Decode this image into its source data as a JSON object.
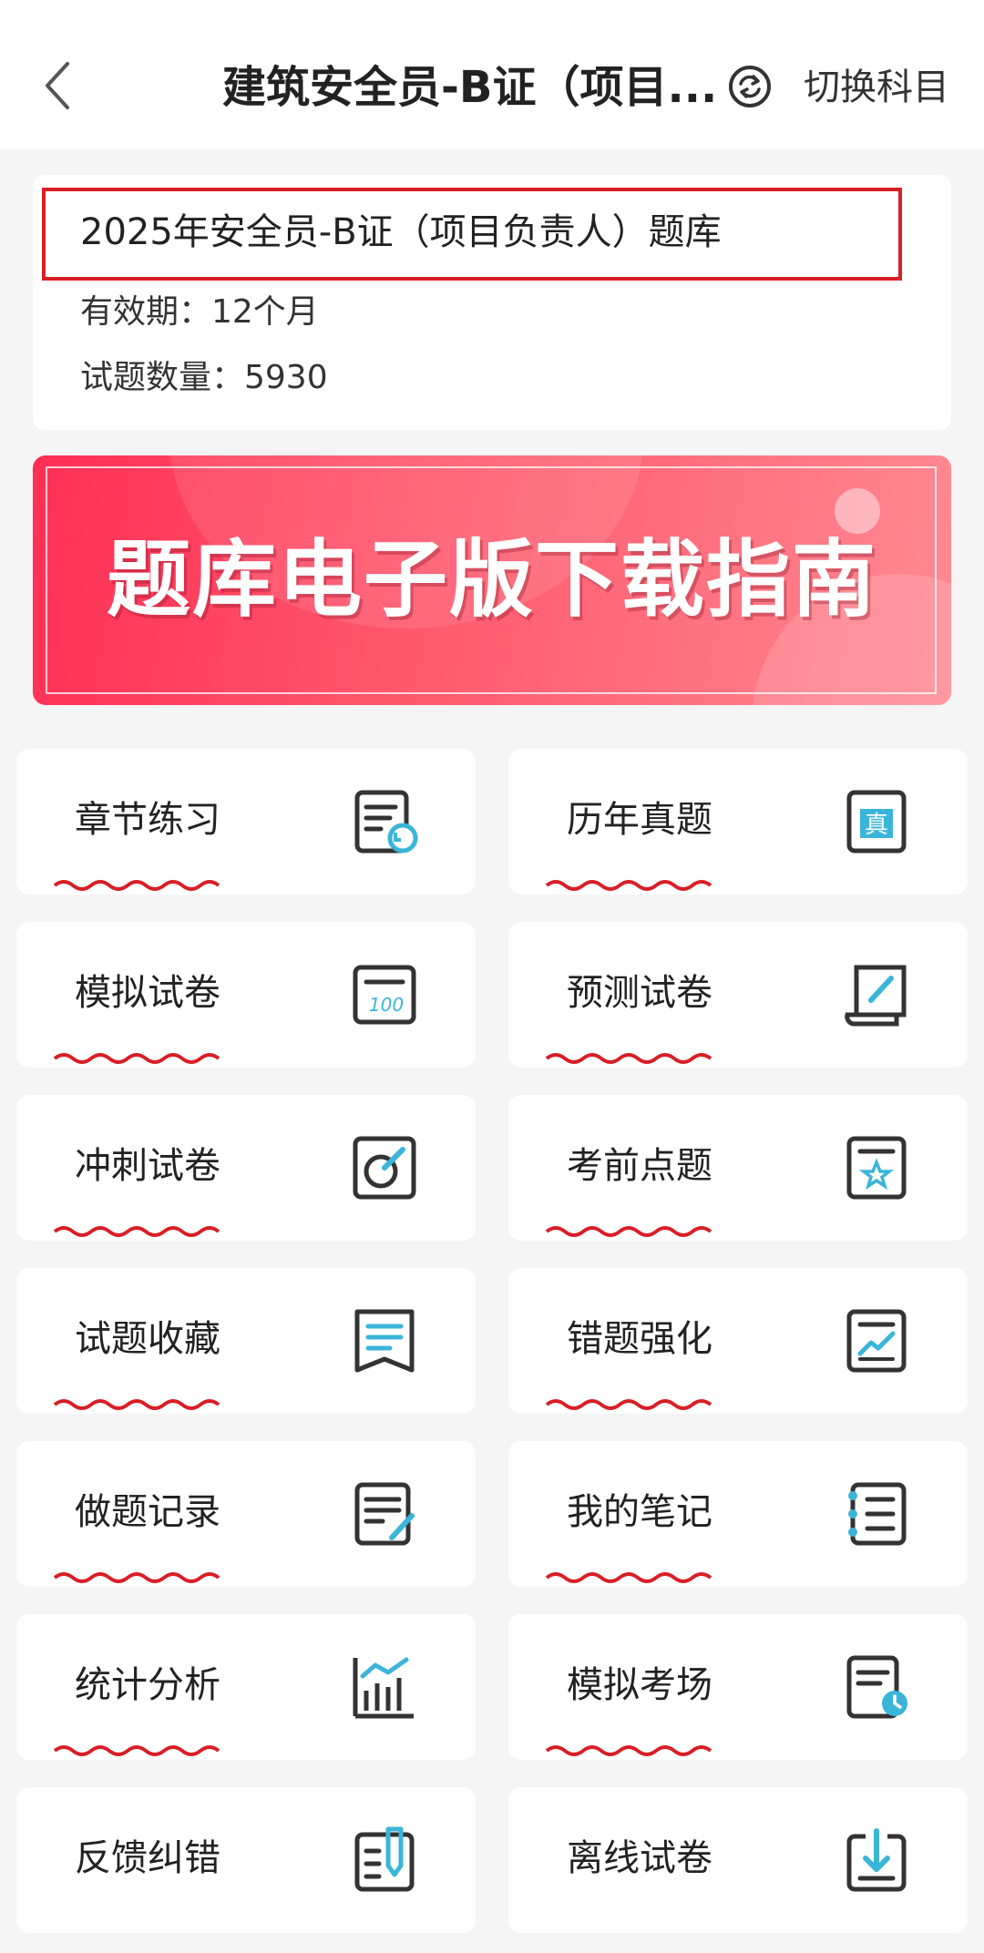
{
  "header": {
    "title": "建筑安全员-B证（项目...",
    "switch_label": "切换科目"
  },
  "info": {
    "title": "2025年安全员-B证（项目负责人）题库",
    "validity": "有效期：12个月",
    "question_count": "试题数量：5930"
  },
  "banner": {
    "text": "题库电子版下载指南"
  },
  "colors": {
    "accent_red": "#d81e26",
    "icon_teal": "#3ab5d9",
    "icon_dark": "#333333"
  },
  "menu": [
    {
      "label": "章节练习",
      "icon": "chapter-practice-icon"
    },
    {
      "label": "历年真题",
      "icon": "past-exam-icon"
    },
    {
      "label": "模拟试卷",
      "icon": "mock-paper-icon"
    },
    {
      "label": "预测试卷",
      "icon": "predicted-paper-icon"
    },
    {
      "label": "冲刺试卷",
      "icon": "sprint-paper-icon"
    },
    {
      "label": "考前点题",
      "icon": "pre-exam-tips-icon"
    },
    {
      "label": "试题收藏",
      "icon": "favorites-icon"
    },
    {
      "label": "错题强化",
      "icon": "mistakes-icon"
    },
    {
      "label": "做题记录",
      "icon": "practice-record-icon"
    },
    {
      "label": "我的笔记",
      "icon": "notes-icon"
    },
    {
      "label": "统计分析",
      "icon": "statistics-icon"
    },
    {
      "label": "模拟考场",
      "icon": "mock-exam-room-icon"
    },
    {
      "label": "反馈纠错",
      "icon": "feedback-icon"
    },
    {
      "label": "离线试卷",
      "icon": "offline-paper-icon"
    }
  ]
}
